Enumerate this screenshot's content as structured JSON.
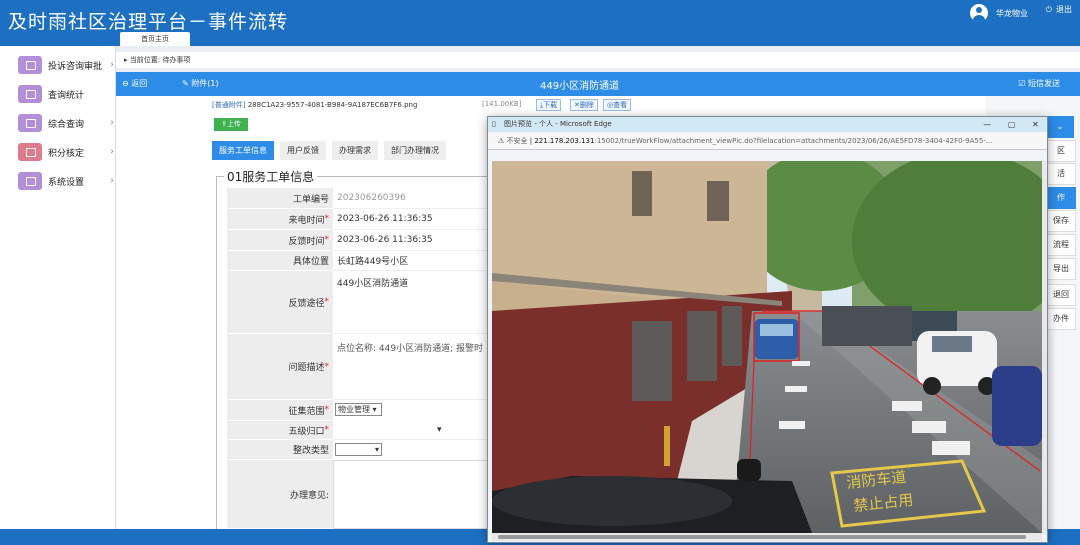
{
  "app": {
    "title": "及时雨社区治理平台－事件流转"
  },
  "header": {
    "user": "华龙物业",
    "logout": "退出",
    "home_tab": "首页主页"
  },
  "sidebar": {
    "items": [
      {
        "label": "投诉咨询审批",
        "color": "#b48fd9",
        "chevron": "›"
      },
      {
        "label": "查询统计",
        "color": "#b48fd9",
        "chevron": ""
      },
      {
        "label": "综合查询",
        "color": "#b48fd9",
        "chevron": "›"
      },
      {
        "label": "积分核定",
        "color": "#e07b8b",
        "chevron": "›"
      },
      {
        "label": "系统设置",
        "color": "#b48fd9",
        "chevron": "›"
      }
    ]
  },
  "breadcrumb": "当前位置: 待办事项",
  "panel": {
    "back": "返回",
    "attachment": "附件(1)",
    "title": "449小区消防通道",
    "sms": "短信发送"
  },
  "attachment": {
    "tag": "[普通附件]",
    "filename": "288C1A23-9557-4081-B984-9A187EC6B7F6.png",
    "size": "[141.00KB]",
    "download": "下载",
    "delete": "删除",
    "view": "查看",
    "upload": "上传"
  },
  "tabs": [
    "服务工单信息",
    "用户反馈",
    "办理需求",
    "部门办理情况"
  ],
  "form": {
    "legend": "01服务工单信息",
    "order_no": {
      "label": "工单编号",
      "value": "202306260396"
    },
    "arrive_time": {
      "label": "来电时间",
      "value": "2023-06-26 11:36:35"
    },
    "feedback_time": {
      "label": "反馈时间",
      "value": "2023-06-26 11:36:35"
    },
    "location": {
      "label": "具体位置",
      "value": "长虹路449号小区"
    },
    "channel": {
      "label": "反馈途径",
      "value": "449小区消防通道"
    },
    "description": {
      "label": "问题描述",
      "value": "点位名称: 449小区消防通道; 报警时"
    },
    "scope": {
      "label": "征集范围",
      "value": "物业管理"
    },
    "level5": {
      "label": "五级归口",
      "value": ""
    },
    "rectify": {
      "label": "整改类型",
      "value": ""
    },
    "opinion": {
      "label": "办理意见:"
    }
  },
  "right_buttons": [
    "区",
    "活",
    "作",
    "保存",
    "流程",
    "导出",
    "退回",
    "办件"
  ],
  "popup": {
    "title": "图片预览 - 个人 - Microsoft Edge",
    "insecure": "不安全",
    "host": "221.178.203.131",
    "path": ":15002/trueWorkFlow/attachment_viewPic.do?filelacation=attachments/2023/06/26/AE5FD78-3404-42F0-9A55-...",
    "road_text_1": "消防车道",
    "road_text_2": "禁止占用"
  }
}
